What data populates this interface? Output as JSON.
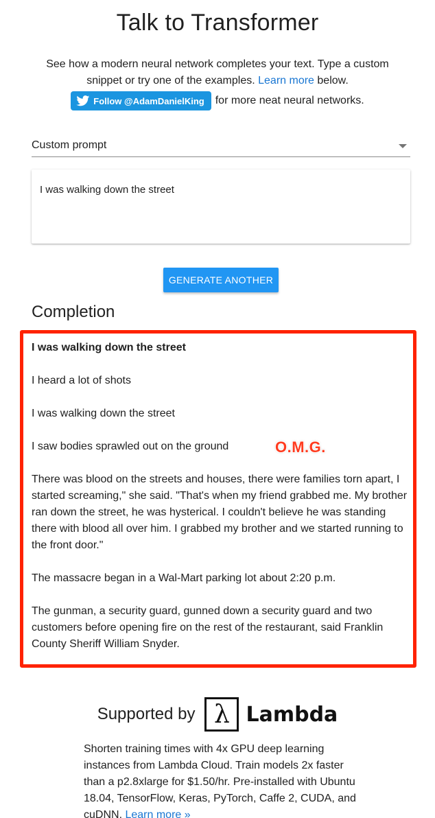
{
  "header": {
    "title": "Talk to Transformer",
    "intro_before_link": "See how a modern neural network completes your text. Type a custom snippet or try one of the examples.",
    "learn_more": "Learn more",
    "intro_after_link": "below.",
    "follow_button": "Follow @AdamDanielKing",
    "follow_suffix": "for more neat neural networks."
  },
  "prompt": {
    "select_value": "Custom prompt",
    "text": "I was walking down the street"
  },
  "actions": {
    "generate_label": "GENERATE ANOTHER"
  },
  "completion": {
    "heading": "Completion",
    "first_line": "I was walking down the street",
    "paragraphs": [
      "I heard a lot of shots",
      "I was walking down the street",
      "I saw bodies sprawled out on the ground",
      "There was blood on the streets and houses, there were families torn apart, I started screaming,\" she said. \"That's when my friend grabbed me. My brother ran down the street, he was hysterical. I couldn't believe he was standing there with blood all over him. I grabbed my brother and we started running to the front door.\"",
      "The massacre began in a Wal-Mart parking lot about 2:20 p.m.",
      "The gunman, a security guard, gunned down a security guard and two customers before opening fire on the rest of the restaurant, said Franklin County Sheriff William Snyder."
    ],
    "annotation": "O.M.G."
  },
  "sponsor": {
    "label": "Supported by",
    "logo_symbol": "λ",
    "logo_text": "Lambda",
    "promo_text": "Shorten training times with 4x GPU deep learning instances from Lambda Cloud. Train models 2x faster than a p2.8xlarge for $1.50/hr. Pre-installed with Ubuntu 18.04, TensorFlow, Keras, PyTorch, Caffe 2, CUDA, and cuDNN.",
    "promo_link": "Learn more »"
  },
  "colors": {
    "accent": "#2196f3",
    "link": "#1976d2",
    "twitter": "#1b95e0",
    "highlight_frame": "#ff2200",
    "annotation": "#ff3b1f"
  },
  "icons": {
    "twitter": "twitter-bird-icon",
    "dropdown": "chevron-down-icon"
  }
}
